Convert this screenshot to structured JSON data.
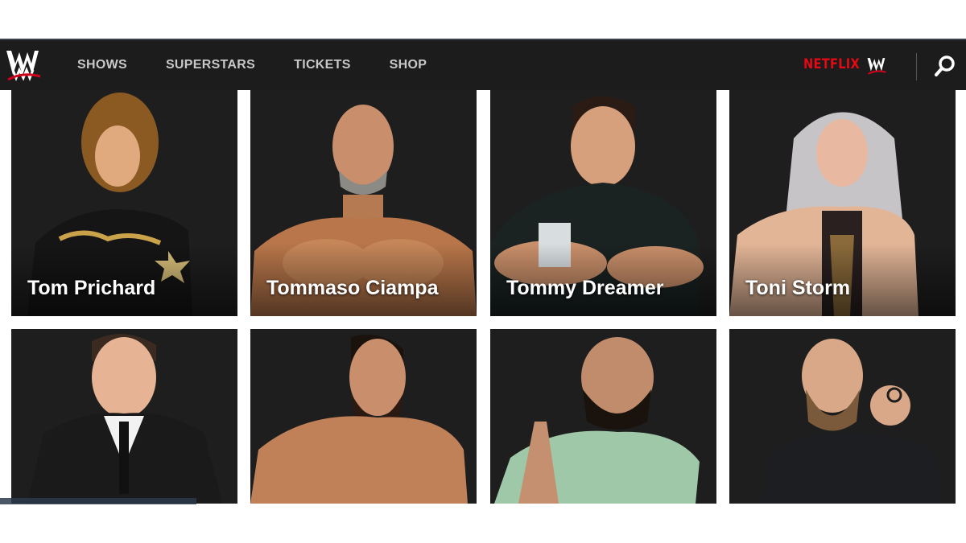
{
  "nav": {
    "logo_icon": "wwe-logo-icon",
    "links": [
      {
        "label": "SHOWS"
      },
      {
        "label": "SUPERSTARS"
      },
      {
        "label": "TICKETS"
      },
      {
        "label": "SHOP"
      }
    ],
    "partner_label": "NETFLIX",
    "partner_icon": "wwe-logo-icon",
    "search_icon": "search-icon",
    "accent_color": "#e50914"
  },
  "superstars": [
    {
      "name": "Tom Prichard"
    },
    {
      "name": "Tommaso Ciampa"
    },
    {
      "name": "Tommy Dreamer"
    },
    {
      "name": "Toni Storm"
    },
    {
      "name": ""
    },
    {
      "name": ""
    },
    {
      "name": ""
    },
    {
      "name": ""
    }
  ]
}
